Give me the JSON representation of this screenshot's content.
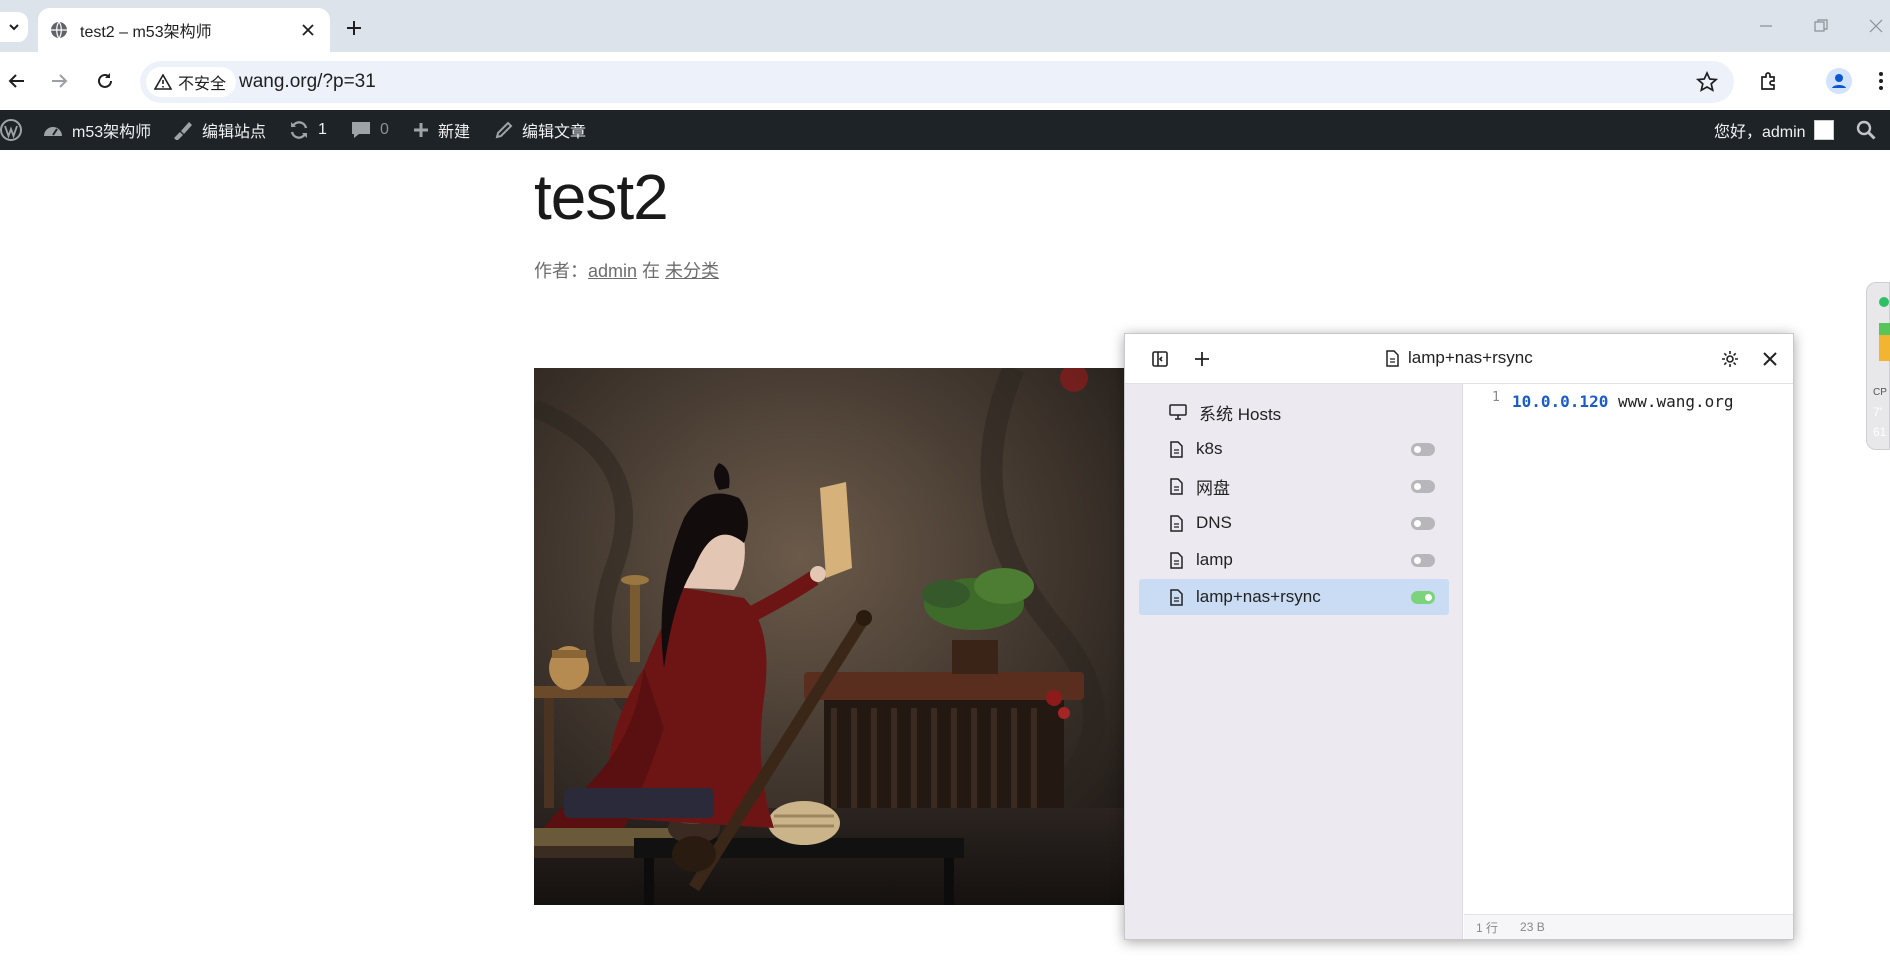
{
  "browser": {
    "tab_title": "test2 – m53架构师",
    "security_label": "不安全",
    "url": "wang.org/?p=31"
  },
  "wp_adminbar": {
    "site_name": "m53架构师",
    "edit_site": "编辑站点",
    "updates_count": "1",
    "comments_count": "0",
    "new_label": "新建",
    "edit_post": "编辑文章",
    "greeting": "您好，admin"
  },
  "post": {
    "title": "test2",
    "meta_prefix": "作者：",
    "author": "admin",
    "meta_in": " 在 ",
    "category": "未分类"
  },
  "side_widget": {
    "line1": "CP",
    "line2": "7'",
    "line3": "61"
  },
  "hosts_panel": {
    "current_title": "lamp+nas+rsync",
    "items": [
      {
        "label": "系统 Hosts",
        "icon": "monitor-icon",
        "toggle": null
      },
      {
        "label": "k8s",
        "icon": "file-icon",
        "toggle": "off"
      },
      {
        "label": "网盘",
        "icon": "file-icon",
        "toggle": "off"
      },
      {
        "label": "DNS",
        "icon": "file-icon",
        "toggle": "off"
      },
      {
        "label": "lamp",
        "icon": "file-icon",
        "toggle": "off"
      },
      {
        "label": "lamp+nas+rsync",
        "icon": "file-icon",
        "toggle": "on"
      }
    ],
    "editor": {
      "line_number": "1",
      "ip": "10.0.0.120",
      "host": " www.wang.org"
    },
    "status": {
      "lines": "1 行",
      "size": "23 B"
    }
  },
  "colors": {
    "tabstrip": "#dde3ea",
    "wpbar": "#1d2327",
    "active_item": "#c9dcf3",
    "toggle_on": "#7bd37b",
    "ip_color": "#1a5dc6"
  }
}
